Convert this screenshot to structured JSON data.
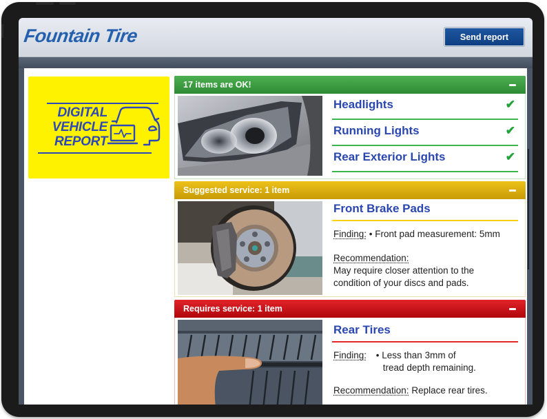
{
  "app": {
    "brand": "Fountain Tire",
    "send_button_label": "Send report"
  },
  "banner": {
    "lines": [
      "DIGITAL",
      "VEHICLE",
      "REPORT"
    ],
    "icon": "car-with-laptop-icon"
  },
  "sections": {
    "ok": {
      "header": "17 items are OK!",
      "color": "#3bb54a",
      "collapse_icon": "minus-icon",
      "photo": "headlight-photo",
      "items": [
        {
          "label": "Headlights",
          "status_icon": "checkmark-icon",
          "status_glyph": "✔"
        },
        {
          "label": "Running Lights",
          "status_icon": "checkmark-icon",
          "status_glyph": "✔"
        },
        {
          "label": "Rear Exterior Lights",
          "status_icon": "checkmark-icon",
          "status_glyph": "✔"
        }
      ]
    },
    "suggested": {
      "header": "Suggested service: 1 item",
      "color": "#f2c40f",
      "collapse_icon": "minus-icon",
      "photo": "brake-disc-photo",
      "item": {
        "title": "Front Brake Pads",
        "finding_label": "Finding:",
        "finding_text": "• Front pad measurement: 5mm",
        "recommendation_label": "Recommendation:",
        "recommendation_line1": "May require closer attention to the",
        "recommendation_line2": "condition of your discs and pads."
      }
    },
    "requires": {
      "header": "Requires service: 1 item",
      "color": "#e0242a",
      "collapse_icon": "minus-icon",
      "photo": "tire-tread-photo",
      "item": {
        "title": "Rear Tires",
        "finding_label": "Finding:",
        "finding_line1": "• Less than 3mm of",
        "finding_line2": "tread depth remaining.",
        "recommendation_label": "Recommendation:",
        "recommendation_text": "Replace rear tires."
      }
    }
  }
}
